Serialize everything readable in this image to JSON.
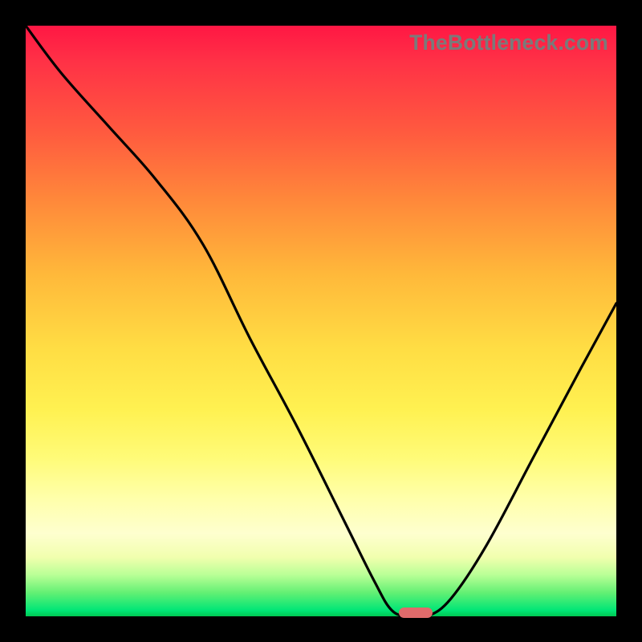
{
  "watermark": "TheBottleneck.com",
  "colors": {
    "page_bg": "#000000",
    "curve": "#000000",
    "marker": "#e06b6b",
    "gradient_top": "#ff1744",
    "gradient_bottom": "#00c853"
  },
  "chart_data": {
    "type": "line",
    "title": "",
    "xlabel": "",
    "ylabel": "",
    "xlim": [
      0,
      100
    ],
    "ylim": [
      0,
      100
    ],
    "grid": false,
    "legend": false,
    "series": [
      {
        "name": "bottleneck-curve",
        "x": [
          0,
          6,
          14,
          22,
          30,
          38,
          46,
          54,
          59,
          62,
          65,
          68,
          72,
          78,
          86,
          94,
          100
        ],
        "values": [
          100,
          92,
          83,
          74,
          63,
          47,
          32,
          16,
          6,
          1,
          0,
          0,
          3,
          12,
          27,
          42,
          53
        ]
      }
    ],
    "marker": {
      "x": 66,
      "y": 0.6,
      "width": 5.7,
      "height": 1.8
    },
    "background_gradient": {
      "direction": "vertical",
      "meaning": "value-scale (red=high, green=low)"
    }
  }
}
